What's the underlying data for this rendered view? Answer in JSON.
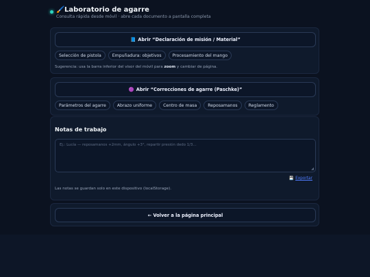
{
  "header": {
    "title": "Laboratorio de agarre",
    "subtitle": "Consulta rápida desde móvil · abre cada documento a pantalla completa"
  },
  "doc1": {
    "button_icon": "📘",
    "button_label": "Abrir “Declaración de misión / Material”",
    "chips": [
      "Selección de pistola",
      "Empuñadura: objetivos",
      "Procesamiento del mango"
    ],
    "hint_before": "Sugerencia: usa la barra inferior del visor del móvil para ",
    "hint_bold": "zoom",
    "hint_after": " y cambiar de página."
  },
  "doc2": {
    "button_icon": "🟣",
    "button_label": "Abrir “Correcciones de agarre (Paschke)”",
    "chips": [
      "Parámetros del agarre",
      "Abrazo uniforme",
      "Centro de masa",
      "Reposamanos",
      "Reglamento"
    ]
  },
  "notes": {
    "title": "Notas de trabajo",
    "placeholder": "Ej.: Lucía — reposamanos +2mm, ángulo +3°, repartir presión dedo 1/3…",
    "export_label": "Exportar",
    "storage_note": "Las notas se guardan solo en este dispositivo (localStorage)."
  },
  "nav": {
    "back_label": "← Volver a la página principal"
  }
}
